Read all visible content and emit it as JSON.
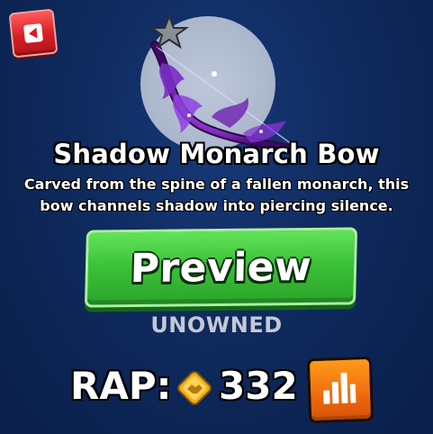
{
  "item": {
    "name": "Shadow Monarch Bow",
    "description": "Carved from the spine of a fallen monarch, this\nbow channels shadow into piercing silence.",
    "favorite_icon": "star-icon"
  },
  "actions": {
    "back_icon": "back-arrow-icon",
    "preview_label": "Preview",
    "chart_icon": "bar-chart-icon"
  },
  "status": "UNOWNED",
  "rap": {
    "label": "RAP:",
    "value": "332",
    "currency_icon": "handshake-diamond-icon"
  },
  "colors": {
    "preview_green": "#3dc239",
    "back_red": "#d61f24",
    "chart_orange": "#ef6b0c",
    "rap_gold": "#f2b01e",
    "background": "#0f2a5e"
  }
}
